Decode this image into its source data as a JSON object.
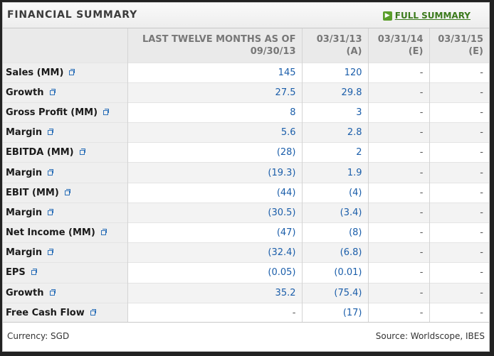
{
  "header": {
    "title": "FINANCIAL SUMMARY",
    "full_summary_label": "FULL SUMMARY",
    "full_summary_icon": "arrow-right-icon"
  },
  "columns": [
    {
      "line1": "LAST TWELVE MONTHS AS OF",
      "line2": "09/30/13"
    },
    {
      "line1": "03/31/13",
      "line2": "(A)"
    },
    {
      "line1": "03/31/14",
      "line2": "(E)"
    },
    {
      "line1": "03/31/15",
      "line2": "(E)"
    }
  ],
  "rows": [
    {
      "label": "Sales (MM)",
      "values": [
        "145",
        "120",
        "-",
        "-"
      ]
    },
    {
      "label": "Growth",
      "values": [
        "27.5",
        "29.8",
        "-",
        "-"
      ]
    },
    {
      "label": "Gross Profit (MM)",
      "values": [
        "8",
        "3",
        "-",
        "-"
      ]
    },
    {
      "label": "Margin",
      "values": [
        "5.6",
        "2.8",
        "-",
        "-"
      ]
    },
    {
      "label": "EBITDA (MM)",
      "values": [
        "(28)",
        "2",
        "-",
        "-"
      ]
    },
    {
      "label": "Margin",
      "values": [
        "(19.3)",
        "1.9",
        "-",
        "-"
      ]
    },
    {
      "label": "EBIT (MM)",
      "values": [
        "(44)",
        "(4)",
        "-",
        "-"
      ]
    },
    {
      "label": "Margin",
      "values": [
        "(30.5)",
        "(3.4)",
        "-",
        "-"
      ]
    },
    {
      "label": "Net Income (MM)",
      "values": [
        "(47)",
        "(8)",
        "-",
        "-"
      ]
    },
    {
      "label": "Margin",
      "values": [
        "(32.4)",
        "(6.8)",
        "-",
        "-"
      ]
    },
    {
      "label": "EPS",
      "values": [
        "(0.05)",
        "(0.01)",
        "-",
        "-"
      ]
    },
    {
      "label": "Growth",
      "values": [
        "35.2",
        "(75.4)",
        "-",
        "-"
      ]
    },
    {
      "label": "Free Cash Flow",
      "values": [
        "-",
        "(17)",
        "-",
        "-"
      ]
    }
  ],
  "footer": {
    "currency": "Currency: SGD",
    "source": "Source: Worldscope, IBES"
  },
  "colors": {
    "value_blue": "#1b5eaa",
    "link_green": "#3b7a1c",
    "icon_green": "#5a9e2a"
  }
}
